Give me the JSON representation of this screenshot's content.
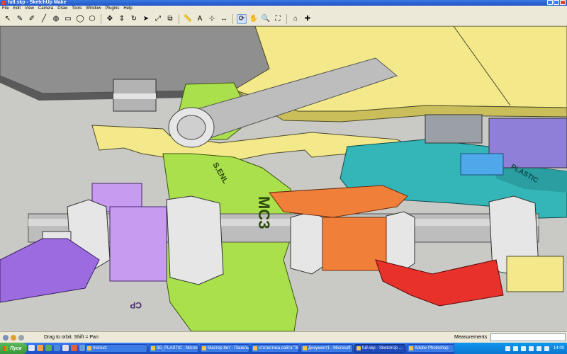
{
  "window": {
    "title": "full.skp - SketchUp Make"
  },
  "menu": [
    "File",
    "Edit",
    "View",
    "Camera",
    "Draw",
    "Tools",
    "Window",
    "Plugins",
    "Help"
  ],
  "toolbar": {
    "tools": [
      {
        "name": "select-tool",
        "glyph": "↖"
      },
      {
        "name": "eraser-tool",
        "glyph": "✎"
      },
      {
        "name": "pencil-tool",
        "glyph": "✐"
      },
      {
        "name": "line-tool",
        "glyph": "╱"
      },
      {
        "name": "paint-bucket-tool",
        "glyph": "◍"
      },
      {
        "name": "rectangle-tool",
        "glyph": "▭"
      },
      {
        "name": "circle-tool",
        "glyph": "◯"
      },
      {
        "name": "polygon-tool",
        "glyph": "⬡"
      },
      {
        "name": "move-tool",
        "glyph": "✥"
      },
      {
        "name": "push-pull-tool",
        "glyph": "⇕"
      },
      {
        "name": "rotate-tool",
        "glyph": "↻"
      },
      {
        "name": "follow-me-tool",
        "glyph": "➤"
      },
      {
        "name": "scale-tool",
        "glyph": "⤢"
      },
      {
        "name": "offset-tool",
        "glyph": "⧉"
      },
      {
        "name": "tape-measure-tool",
        "glyph": "📏"
      },
      {
        "name": "text-tool",
        "glyph": "A"
      },
      {
        "name": "axes-tool",
        "glyph": "⊹"
      },
      {
        "name": "dimension-tool",
        "glyph": "↔"
      },
      {
        "name": "orbit-tool",
        "glyph": "⟳"
      },
      {
        "name": "pan-tool",
        "glyph": "✋"
      },
      {
        "name": "zoom-tool",
        "glyph": "🔍"
      },
      {
        "name": "zoom-extents-tool",
        "glyph": "⛶"
      },
      {
        "name": "warehouse-button",
        "glyph": "⌂"
      },
      {
        "name": "extension-button",
        "glyph": "✚"
      }
    ],
    "active_tool_index": 18
  },
  "model_labels": {
    "mc3": "MC3",
    "brand": "S.ENL",
    "plastic": "PLASTIC",
    "cp": "CP"
  },
  "status": {
    "message": "Drag to orbit.  Shift = Pan",
    "measurements_label": "Measurements",
    "measurements_value": ""
  },
  "taskbar": {
    "start_label": "Пуск",
    "items": [
      {
        "label": "Instruct",
        "active": false
      },
      {
        "label": "3D_PLASTIC - Microsof...",
        "active": false
      },
      {
        "label": "Мастер Кит - Панель ...",
        "active": false
      },
      {
        "label": "статистика сайта \"3D ...",
        "active": false
      },
      {
        "label": "Документ1 - Microsoft ...",
        "active": false
      },
      {
        "label": "full.skp - SketchUp ...",
        "active": true
      },
      {
        "label": "Adobe Photoshop",
        "active": false
      }
    ],
    "clock": "14:00"
  },
  "colors": {
    "yellow": "#f3e98a",
    "lime": "#a9e04b",
    "teal": "#34b5b8",
    "orange": "#f07f3a",
    "red": "#e8312a",
    "violet": "#c69bf0",
    "purple": "#9d6be0",
    "steel": "#bdbdbd",
    "nut": "#e6e6e6"
  }
}
